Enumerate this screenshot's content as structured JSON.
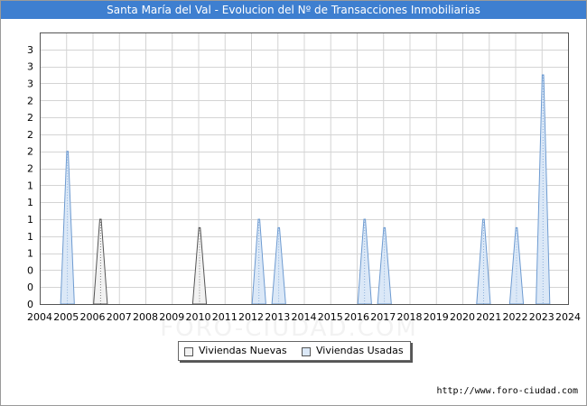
{
  "page": {
    "title": "Santa María del Val - Evolucion del Nº de Transacciones Inmobiliarias",
    "source": "http://www.foro-ciudad.com",
    "watermark": "FORO-CIUDAD.COM"
  },
  "colors": {
    "title_bg": "#3e7fd0",
    "nuevas_fill": "#f2f2f2",
    "nuevas_stroke": "#555555",
    "usadas_fill": "#dbe8f7",
    "usadas_stroke": "#6e9bd1"
  },
  "chart_data": {
    "type": "area",
    "title": "Santa María del Val - Evolucion del Nº de Transacciones Inmobiliarias",
    "x_tick_labels": [
      "2004",
      "2005",
      "2006",
      "2007",
      "2008",
      "2009",
      "2010",
      "2011",
      "2012",
      "2013",
      "2014",
      "2015",
      "2016",
      "2017",
      "2018",
      "2019",
      "2020",
      "2021",
      "2022",
      "2023",
      "2024"
    ],
    "y_tick_labels": [
      "0",
      "0",
      "0",
      "1",
      "1",
      "1",
      "1",
      "1",
      "2",
      "2",
      "2",
      "2",
      "2",
      "3",
      "3",
      "3"
    ],
    "xlim": [
      2004,
      2024
    ],
    "ylim": [
      0,
      3.2
    ],
    "grid": true,
    "legend_position": "bottom",
    "series": [
      {
        "name": "Viviendas Nuevas",
        "peaks": [
          {
            "x": 2006.3,
            "y": 1.0
          },
          {
            "x": 2010.05,
            "y": 0.9
          }
        ]
      },
      {
        "name": "Viviendas Usadas",
        "peaks": [
          {
            "x": 2005.05,
            "y": 1.8
          },
          {
            "x": 2012.3,
            "y": 1.0
          },
          {
            "x": 2013.05,
            "y": 0.9
          },
          {
            "x": 2016.3,
            "y": 1.0
          },
          {
            "x": 2017.05,
            "y": 0.9
          },
          {
            "x": 2020.8,
            "y": 1.0
          },
          {
            "x": 2022.05,
            "y": 0.9
          },
          {
            "x": 2023.05,
            "y": 2.7
          }
        ]
      }
    ]
  }
}
